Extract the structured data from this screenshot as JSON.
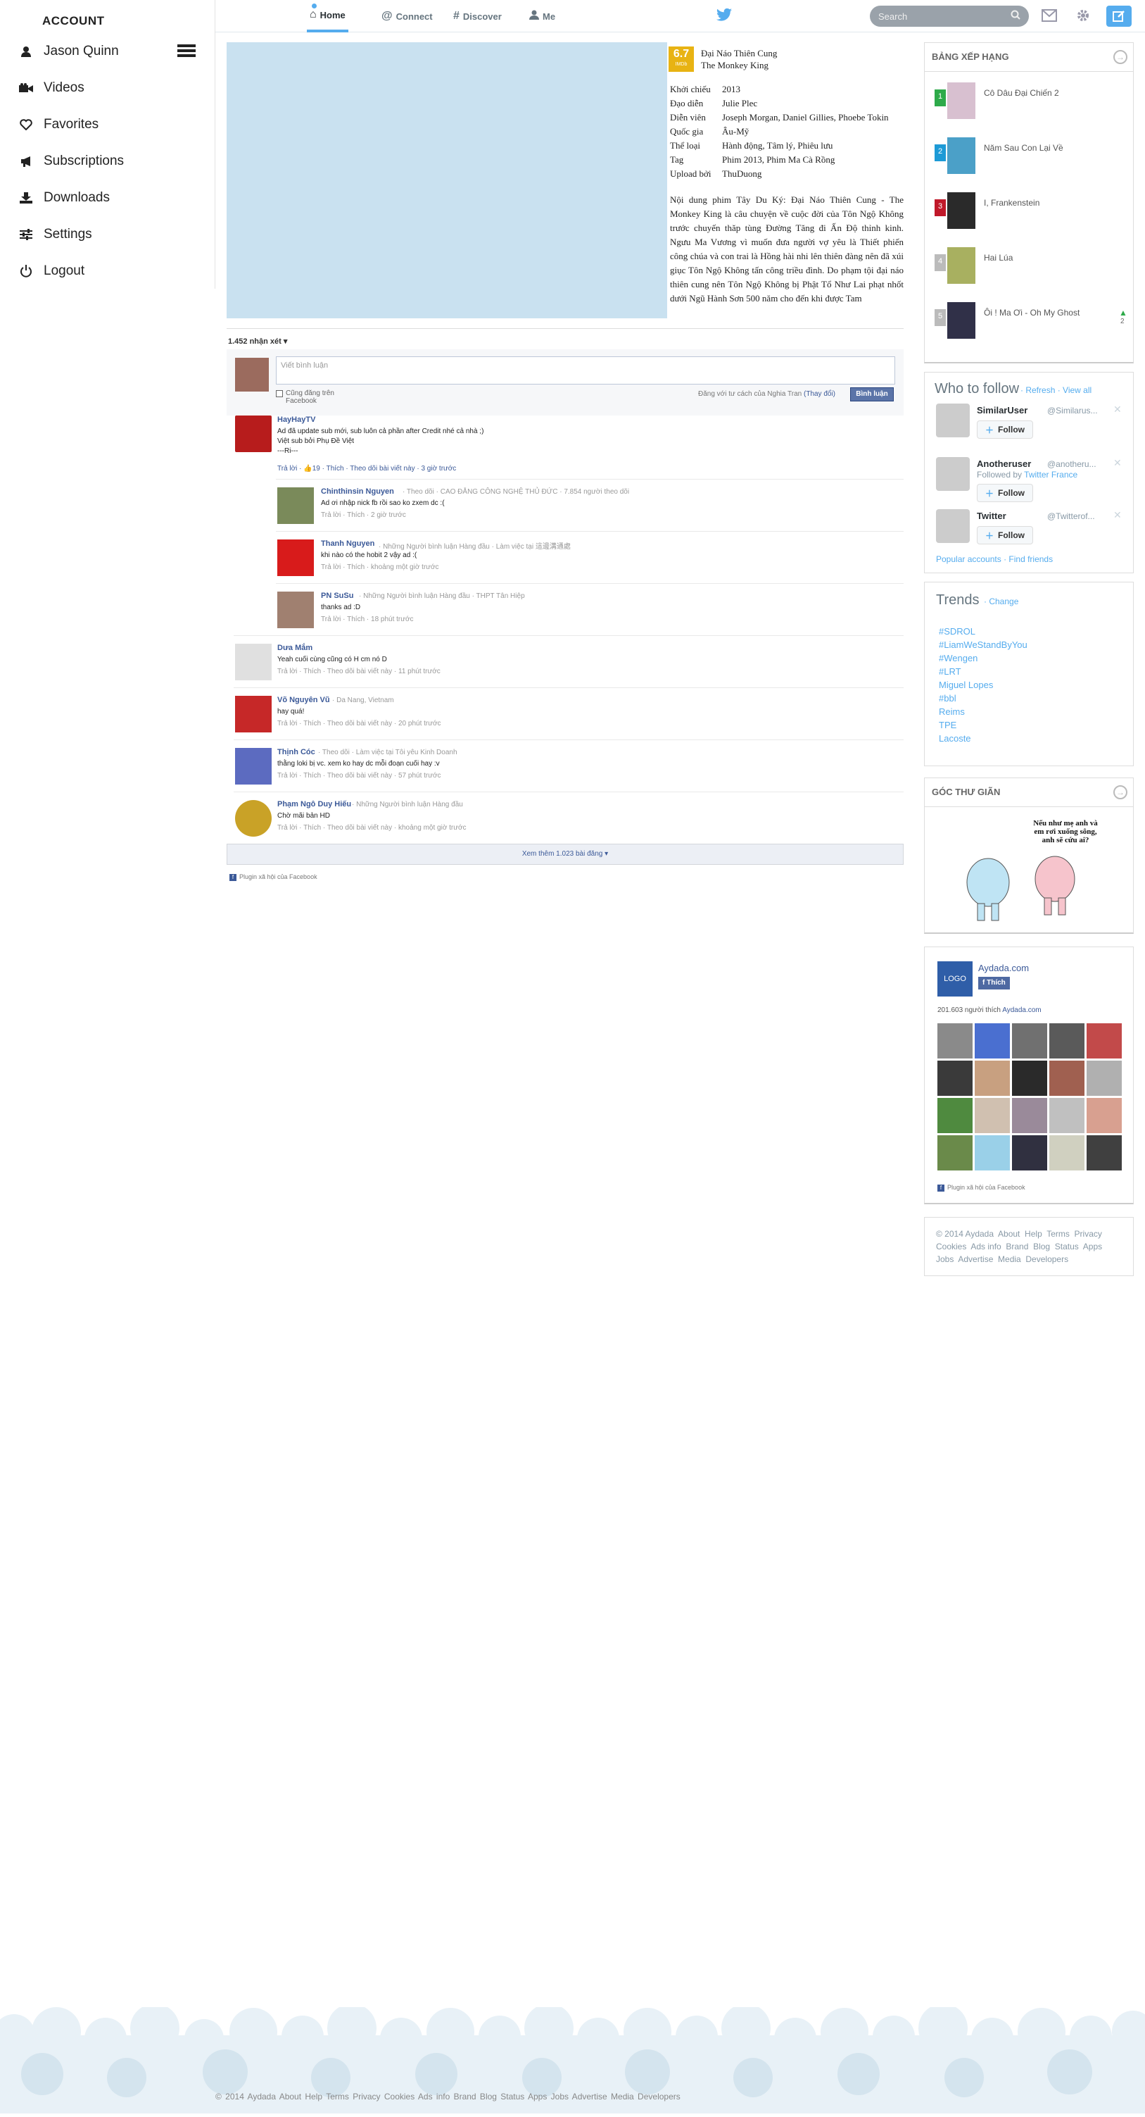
{
  "account": {
    "header": "ACCOUNT",
    "items": [
      {
        "label": "Jason Quinn",
        "icon": "user-icon"
      },
      {
        "label": "Videos",
        "icon": "video-camera-icon"
      },
      {
        "label": "Favorites",
        "icon": "heart-icon"
      },
      {
        "label": "Subscriptions",
        "icon": "megaphone-icon"
      },
      {
        "label": "Downloads",
        "icon": "download-icon"
      },
      {
        "label": "Settings",
        "icon": "sliders-icon"
      },
      {
        "label": "Logout",
        "icon": "power-icon"
      }
    ]
  },
  "topnav": {
    "tabs": [
      "Home",
      "Connect",
      "Discover",
      "Me"
    ],
    "active_tab": "Home",
    "search_placeholder": "Search",
    "accent": "#55acee"
  },
  "movie": {
    "rating": "6.7",
    "rating_label": "IMDb",
    "title_vi": "Đại Náo Thiên Cung",
    "title_en": "The Monkey King",
    "details": [
      {
        "k": "Khởi chiếu",
        "v": "2013"
      },
      {
        "k": "Đạo diễn",
        "v": "Julie Plec"
      },
      {
        "k": "Diễn viên",
        "v": "Joseph Morgan, Daniel Gillies, Phoebe Tokin"
      },
      {
        "k": "Quốc gia",
        "v": "Âu-Mỹ"
      },
      {
        "k": "Thể loại",
        "v": "Hành động, Tâm lý, Phiêu lưu"
      },
      {
        "k": "Tag",
        "v": "Phim 2013, Phim Ma Cà Rồng"
      },
      {
        "k": "Upload bởi",
        "v": "ThuDuong"
      }
    ],
    "description": "Nội dung phim Tây Du Ký: Đại Náo Thiên Cung - The Monkey King là câu chuyện về cuộc đời của Tôn Ngộ Không trước chuyến thăp tùng Đường Tăng đi Ấn Độ thỉnh kinh. Ngưu Ma Vương vì muốn đưa người vợ yêu là Thiết phiến công chúa và con trai là Hồng hài nhi lên thiên đàng nên đã xúi giục Tôn Ngộ Không tấn công triều đình. Do phạm tội đại náo thiên cung nên Tôn Ngộ Không bị Phật Tổ Như Lai phạt nhốt dưới Ngũ Hành Sơn 500 năm cho đến khi được Tam"
  },
  "comments": {
    "count_label": "1.452 nhận xét",
    "input_placeholder": "Viết bình luận",
    "post_fb_label": "Cũng đăng trên Facebook",
    "signed_in_as": "Đăng với tư cách của Nghia Tran",
    "change_label": "(Thay đổi)",
    "submit_label": "Bình luận",
    "items": [
      {
        "name": "HayHayTV",
        "meta": "",
        "text": "Ad đã update sub mới, sub luôn cả phần after Credit nhé cả nhà ;)\nViệt sub bởi Phụ Đề Việt\n---Ri---",
        "actions": "Trả lời · ",
        "likes": "19",
        "actions2": " · Thích · Theo dõi bài viết này · 3 giờ trước"
      },
      {
        "name": "Chinthinsin Nguyen",
        "meta": "· Theo dõi · CAO ĐẲNG CÔNG NGHỆ THỦ ĐỨC · 7.854 người theo dõi",
        "text": "Ad ơi nhập nick fb rồi sao ko zxem dc :(",
        "actions": "Trả lời · Thích · 2 giờ trước"
      },
      {
        "name": "Thanh Nguyen",
        "meta": "· Những Người bình luận Hàng đầu · Làm việc tại 這邊溝通處",
        "text": "khi nào có the hobit 2 vậy ad :(",
        "actions": "Trả lời · Thích · khoảng một giờ trước"
      },
      {
        "name": "PN SuSu",
        "meta": "· Những Người bình luận Hàng đầu · THPT Tân Hiệp",
        "text": "thanks ad :D",
        "actions": "Trả lời · Thích · 18 phút trước"
      },
      {
        "name": "Dưa Mắm",
        "meta": "",
        "text": "Yeah cuối cùng cũng có H cm nó D",
        "actions": "Trả lời · Thích · Theo dõi bài viết này · 11 phút trước"
      },
      {
        "name": "Võ Nguyên Vũ",
        "meta": "· Da Nang, Vietnam",
        "text": "hay quá!",
        "actions": "Trả lời · Thích · Theo dõi bài viết này · 20 phút trước"
      },
      {
        "name": "Thịnh Cóc",
        "meta": "· Theo dõi · Làm việc tại Tôi yêu Kinh Doanh",
        "text": "thằng loki bị vc. xem ko hay dc mỗi đoạn cuối hay :v",
        "actions": "Trả lời · Thích · Theo dõi bài viết này · 57 phút trước"
      },
      {
        "name": "Phạm Ngô Duy Hiếu",
        "meta": "· Những Người bình luận Hàng đầu",
        "text": "Chờ mãi bản HD",
        "actions": "Trả lời · Thích · Theo dõi bài viết này · khoảng một giờ trước"
      }
    ],
    "load_more": "Xem thêm 1.023 bài đăng",
    "plugin_label": "Plugin xã hội của Facebook"
  },
  "ranking": {
    "title": "BẢNG XẾP HẠNG",
    "items": [
      {
        "rank": "1",
        "name": "Cô Dâu Đại Chiến 2",
        "color": "#2eaa4a"
      },
      {
        "rank": "2",
        "name": "Năm Sau Con Lại Về",
        "color": "#1d9ad6"
      },
      {
        "rank": "3",
        "name": "I, Frankenstein",
        "color": "#c0192a"
      },
      {
        "rank": "4",
        "name": "Hai Lúa",
        "color": "#bbbbbb"
      },
      {
        "rank": "5",
        "name": "Ôi ! Ma Ơi - Oh My Ghost",
        "color": "#bbbbbb"
      }
    ],
    "trend_value": "2"
  },
  "who_to_follow": {
    "title": "Who to follow",
    "refresh": "Refresh",
    "view_all": "View all",
    "users": [
      {
        "name": "SimilarUser",
        "handle": "@Similarus...",
        "sub": ""
      },
      {
        "name": "Anotheruser",
        "handle": "@anotheru...",
        "sub": "Followed by",
        "sub_link": "Twitter France"
      },
      {
        "name": "Twitter",
        "handle": "@Twitterof...",
        "sub": ""
      }
    ],
    "follow_label": "Follow",
    "popular": "Popular accounts",
    "find": "Find friends"
  },
  "trends": {
    "title": "Trends",
    "change": "Change",
    "items": [
      "#SDROL",
      "#LiamWeStandByYou",
      "#Wengen",
      "#LRT",
      "Miguel Lopes",
      "#bbl",
      "Reims",
      "TPE",
      "Lacoste"
    ]
  },
  "corner": {
    "title": "GÓC THƯ GIÃN",
    "caption": "Nếu như mẹ anh và em rơi xuống sông, anh sẽ cứu ai?"
  },
  "fbbox": {
    "logo": "LOGO",
    "page_name": "Aydada.com",
    "like_label": "Thích",
    "likes_text": "201.603 người thích",
    "likes_link": "Aydada.com",
    "plugin_label": "Plugin xã hội của Facebook"
  },
  "footer_right": {
    "line1": "© 2014 Aydada  About  Help  Terms  Privacy",
    "line2": "Cookies  Ads info  Brand  Blog  Status  Apps",
    "line3": "Jobs  Advertise  Media  Developers"
  },
  "footer": {
    "links": "© 2014 Aydada  About  Help  Terms  Privacy  Cookies  Ads info  Brand  Blog  Status  Apps  Jobs  Advertise  Media  Developers"
  }
}
